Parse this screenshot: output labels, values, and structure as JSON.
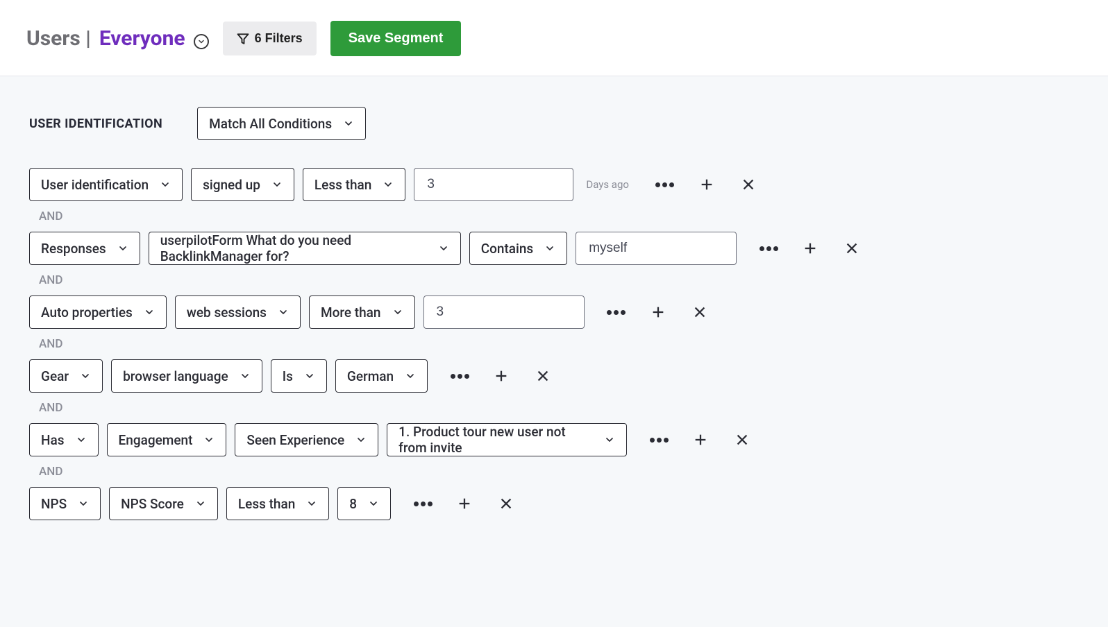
{
  "header": {
    "title_prefix": "Users |",
    "segment_name": "Everyone",
    "filter_count_label": "6 Filters",
    "save_label": "Save Segment"
  },
  "section": {
    "title": "USER IDENTIFICATION",
    "match_mode": "Match All Conditions"
  },
  "separator": "AND",
  "rows": [
    {
      "s1": "User identification",
      "s2": "signed up",
      "s3": "Less than",
      "input": "3",
      "trailing": "Days ago"
    },
    {
      "s1": "Responses",
      "s2": "userpilotForm What do you need BacklinkManager for?",
      "s3": "Contains",
      "input": "myself"
    },
    {
      "s1": "Auto properties",
      "s2": "web sessions",
      "s3": "More than",
      "input": "3"
    },
    {
      "s1": "Gear",
      "s2": "browser language",
      "s3": "Is",
      "s4": "German"
    },
    {
      "s1": "Has",
      "s2": "Engagement",
      "s3": "Seen Experience",
      "s4": "1. Product tour new user not from invite"
    },
    {
      "s1": "NPS",
      "s2": "NPS Score",
      "s3": "Less than",
      "s4": "8"
    }
  ]
}
